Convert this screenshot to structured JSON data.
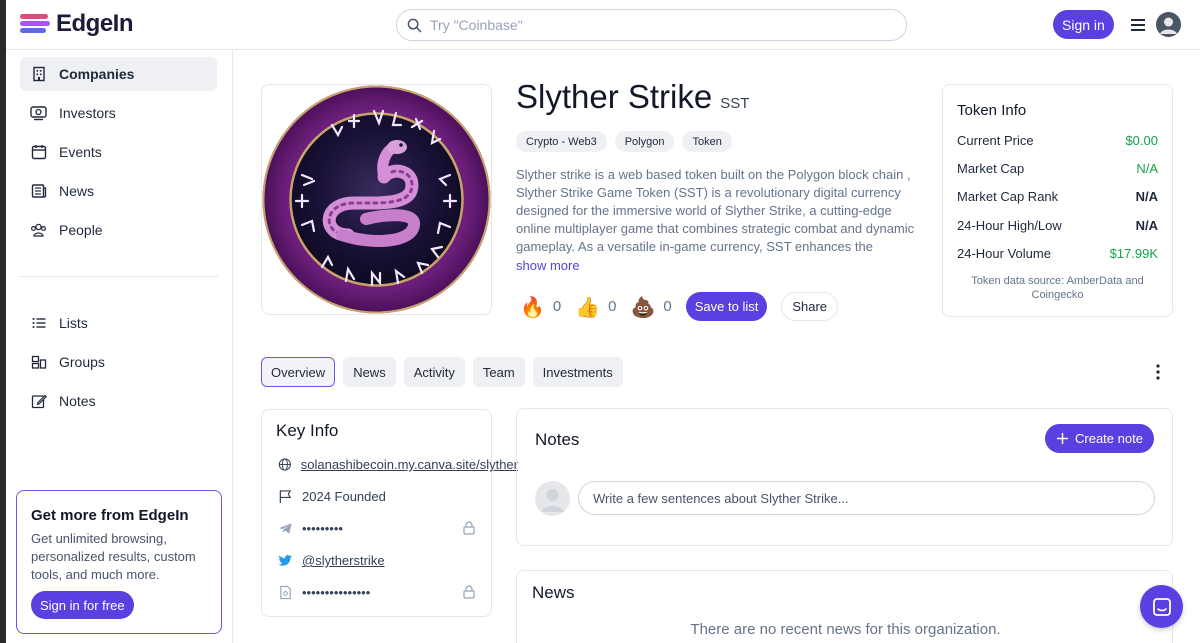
{
  "header": {
    "brand": "EdgeIn",
    "search_placeholder": "Try \"Coinbase\"",
    "signin_label": "Sign in"
  },
  "sidebar": {
    "items": [
      {
        "label": "Companies",
        "icon": "building-icon",
        "active": true
      },
      {
        "label": "Investors",
        "icon": "investors-icon",
        "active": false
      },
      {
        "label": "Events",
        "icon": "calendar-icon",
        "active": false
      },
      {
        "label": "News",
        "icon": "newspaper-icon",
        "active": false
      },
      {
        "label": "People",
        "icon": "people-icon",
        "active": false
      }
    ],
    "secondary": [
      {
        "label": "Lists",
        "icon": "list-icon"
      },
      {
        "label": "Groups",
        "icon": "groups-icon"
      },
      {
        "label": "Notes",
        "icon": "pencil-icon"
      }
    ],
    "promo": {
      "title": "Get more from EdgeIn",
      "body": "Get unlimited browsing, personalized results, custom tools, and much more.",
      "button": "Sign in for free"
    }
  },
  "profile": {
    "name": "Slyther Strike",
    "ticker": "SST",
    "tags": [
      "Crypto - Web3",
      "Polygon",
      "Token"
    ],
    "description": "Slyther strike is a web based token built on the Polygon block chain , Slyther Strike Game Token (SST) is a revolutionary digital currency designed for the immersive world of Slyther Strike, a cutting-edge online multiplayer game that combines strategic combat and dynamic gameplay. As a versatile in-game currency, SST enhances the gamin...",
    "show_more": "show more",
    "reactions": [
      {
        "icon": "fire-icon",
        "glyph": "🔥",
        "count": "0"
      },
      {
        "icon": "thumbs-up-icon",
        "glyph": "👍",
        "count": "0"
      },
      {
        "icon": "poop-icon",
        "glyph": "💩",
        "count": "0"
      }
    ],
    "save_label": "Save to list",
    "share_label": "Share"
  },
  "token_info": {
    "title": "Token Info",
    "rows": [
      {
        "label": "Current Price",
        "value": "$0.00",
        "color": "#16a34a"
      },
      {
        "label": "Market Cap",
        "value": "N/A",
        "color": "#16a34a"
      },
      {
        "label": "Market Cap Rank",
        "value": "N/A",
        "color": "#111827"
      },
      {
        "label": "24-Hour High/Low",
        "value": "N/A",
        "color": "#111827"
      },
      {
        "label": "24-Hour Volume",
        "value": "$17.99K",
        "color": "#16a34a"
      }
    ],
    "source": "Token data source: AmberData and Coingecko"
  },
  "tabs": [
    "Overview",
    "News",
    "Activity",
    "Team",
    "Investments"
  ],
  "key_info": {
    "title": "Key Info",
    "website": "solanashibecoin.my.canva.site/slyther",
    "founded": "2024 Founded",
    "telegram": "•••••••••",
    "twitter": "@slytherstrike",
    "discord": "•••••••••••••••"
  },
  "notes": {
    "title": "Notes",
    "create_label": "Create note",
    "placeholder": "Write a few sentences about Slyther Strike..."
  },
  "news": {
    "title": "News",
    "empty": "There are no recent news for this organization."
  },
  "colors": {
    "accent": "#5b3fe0",
    "positive": "#16a34a"
  }
}
